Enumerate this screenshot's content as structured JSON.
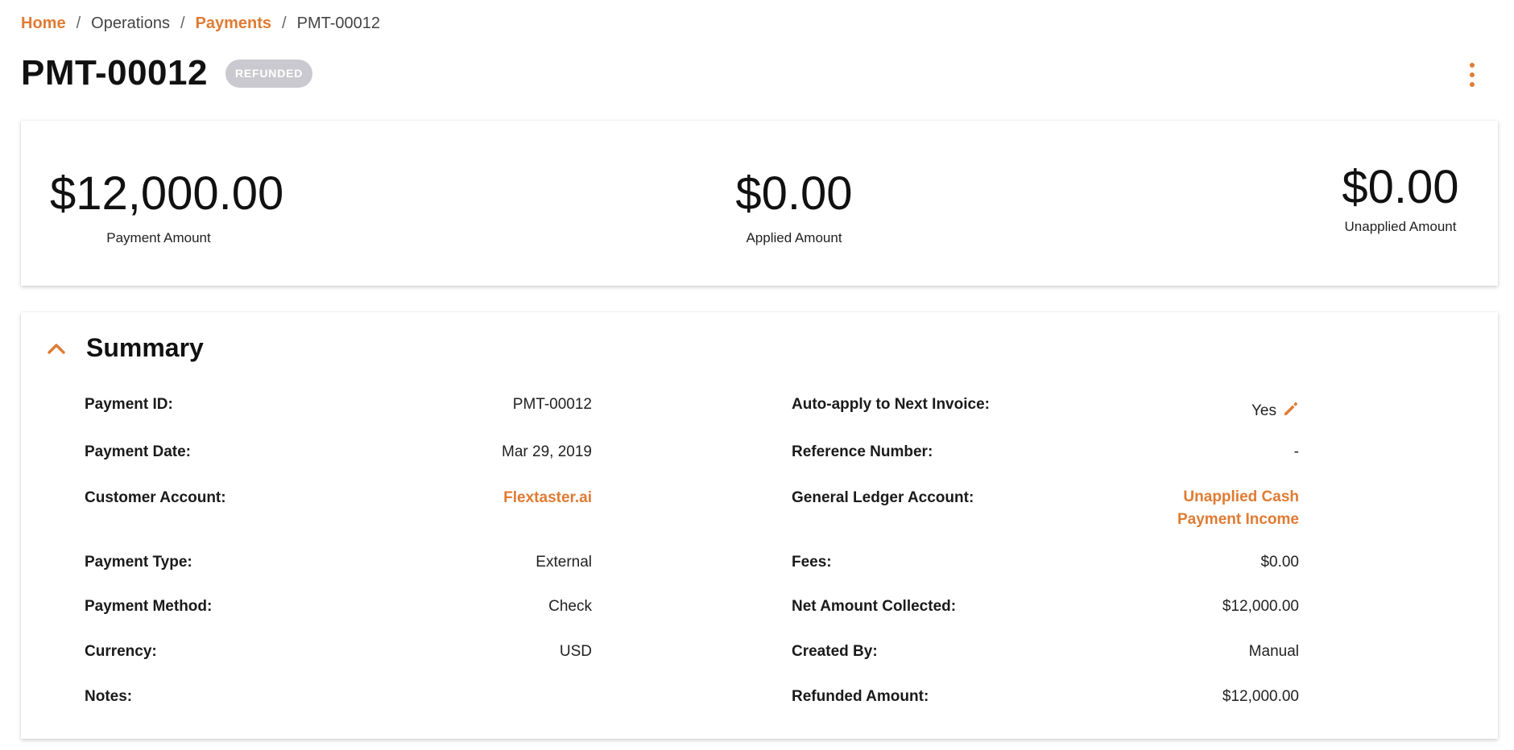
{
  "breadcrumb": {
    "home": "Home",
    "sep1": "/",
    "operations": "Operations",
    "sep2": "/",
    "payments": "Payments",
    "sep3": "/",
    "current": "PMT-00012"
  },
  "header": {
    "title": "PMT-00012",
    "status": "REFUNDED"
  },
  "amounts": {
    "payment_value": "$12,000.00",
    "payment_label": "Payment Amount",
    "applied_value": "$0.00",
    "applied_label": "Applied Amount",
    "unapplied_value": "$0.00",
    "unapplied_label": "Unapplied Amount"
  },
  "summary": {
    "title": "Summary",
    "left": [
      {
        "label": "Payment ID:",
        "value": "PMT-00012"
      },
      {
        "label": "Payment Date:",
        "value": "Mar 29, 2019"
      },
      {
        "label": "Customer Account:",
        "value": "Flextaster.ai"
      },
      {
        "label": "Payment Type:",
        "value": "External"
      },
      {
        "label": "Payment Method:",
        "value": "Check"
      },
      {
        "label": "Currency:",
        "value": "USD"
      },
      {
        "label": "Notes:",
        "value": ""
      }
    ],
    "right": [
      {
        "label": "Auto-apply to Next Invoice:",
        "value": "Yes"
      },
      {
        "label": "Reference Number:",
        "value": "-"
      },
      {
        "label": "General Ledger Account:",
        "value": "Unapplied Cash Payment Income"
      },
      {
        "label": "Fees:",
        "value": "$0.00"
      },
      {
        "label": "Net Amount Collected:",
        "value": "$12,000.00"
      },
      {
        "label": "Created By:",
        "value": "Manual"
      },
      {
        "label": "Refunded Amount:",
        "value": "$12,000.00"
      }
    ]
  },
  "colors": {
    "accent": "#e07b32",
    "badge": "#c9c9cf"
  },
  "icons": {
    "more": "kebab-menu-icon",
    "collapse": "chevron-up-icon",
    "edit": "pencil-icon"
  }
}
